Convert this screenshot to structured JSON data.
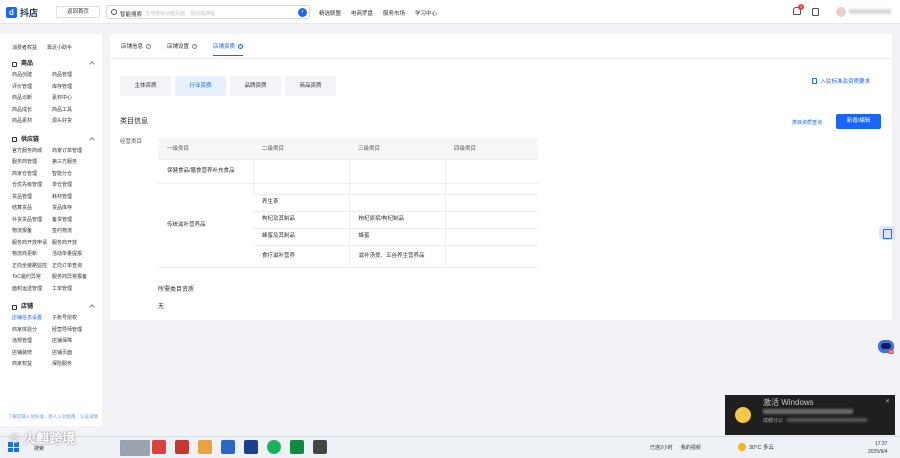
{
  "app": {
    "logo": "抖店",
    "home_button": "返回首页"
  },
  "search": {
    "label": "智能搜索",
    "placeholder": "支持搜索功能页面、规则或课程"
  },
  "topnav": [
    "精选联盟",
    "电商罗盘",
    "服务市场",
    "学习中心"
  ],
  "notify_count": "1",
  "sidebar": {
    "head": [
      "消费者权益",
      "靠近小助手"
    ],
    "groups": [
      {
        "title": "商品",
        "items": [
          "商品创建",
          "商品管理",
          "评价管理",
          "库存管理",
          "商品诊断",
          "素材中心",
          "商品成长",
          "商品工具",
          "商品素材",
          "源头好货"
        ],
        "active": ""
      },
      {
        "title": "供应链",
        "items": [
          "官方服务商城",
          "商家订单管理",
          "服务商管理",
          "第三方服务",
          "商家仓管理",
          "智能分仓",
          "仓优先级管理",
          "单仓管理",
          "货品管理",
          "耗材管理",
          "结算货品",
          "货品库存",
          "补货货品管理",
          "备货管理",
          "物流报备",
          "签约物流",
          "服务商开放申请",
          "服务商开放",
          "物流商更新",
          "活动单量提报",
          "正向全链路监控",
          "正向订单查询",
          "ToC履约异常",
          "服务商异常报备",
          "面积运送管理",
          "工单管理"
        ],
        "active": ""
      },
      {
        "title": "店铺",
        "items": [
          "店铺信息设置",
          "子账号授权",
          "商家体验分",
          "经营导师管理",
          "违规管理",
          "店铺保障",
          "店铺装修",
          "店铺页面",
          "商家权益",
          "保险服务"
        ],
        "active": "店铺信息设置"
      }
    ]
  },
  "tabs": [
    {
      "label": "店铺信息",
      "active": false
    },
    {
      "label": "店铺设置",
      "active": false
    },
    {
      "label": "店铺资质",
      "active": true
    }
  ],
  "segments": [
    {
      "label": "主体资质",
      "active": false
    },
    {
      "label": "行业资质",
      "active": true
    },
    {
      "label": "品牌资质",
      "active": false
    },
    {
      "label": "商品资质",
      "active": false
    }
  ],
  "requirements_link": "入驻标准及资质要求",
  "category": {
    "title": "类目信息",
    "query_link": "类目资质查询",
    "edit_button": "新增/编辑",
    "row_label": "经营类目",
    "columns": [
      "一级类目",
      "二级类目",
      "三级类目",
      "四级类目"
    ],
    "rows": [
      {
        "c1": "保健食品/膳食营养补充食品",
        "c2": "",
        "c3": "",
        "c4": "",
        "c1span": 1
      },
      {
        "c1": "传统滋补营养品",
        "c2": "养生茶",
        "c3": "",
        "c4": "",
        "c1span": 5
      },
      {
        "c2": "枸杞及其制品",
        "c3": "枸杞原浆/枸杞制品",
        "c4": ""
      },
      {
        "c2": "蜂蜜及其制品",
        "c3": "蜂蜜",
        "c4": ""
      },
      {
        "c2": "食疗滋补营养",
        "c3": "滋补汤煲、五谷养生营养品",
        "c4": ""
      }
    ]
  },
  "needed": {
    "title": "所需类目资质",
    "value": "无"
  },
  "bottom_link": "了解店铺入驻标准、新人入驻指南、认证详情",
  "activate_windows": {
    "title": "激活 Windows",
    "line2": "成都分公"
  },
  "taskbar": {
    "search": "搜索",
    "tray_text1": "我的视频",
    "tray_text2": "已连2小时",
    "weather": "30°C 多云",
    "time": "17:37",
    "date": "2025/9/4"
  },
  "watermark": "© 火麒跨境",
  "colors": {
    "accent": "#1966ff",
    "badge": "#f23d3d"
  }
}
